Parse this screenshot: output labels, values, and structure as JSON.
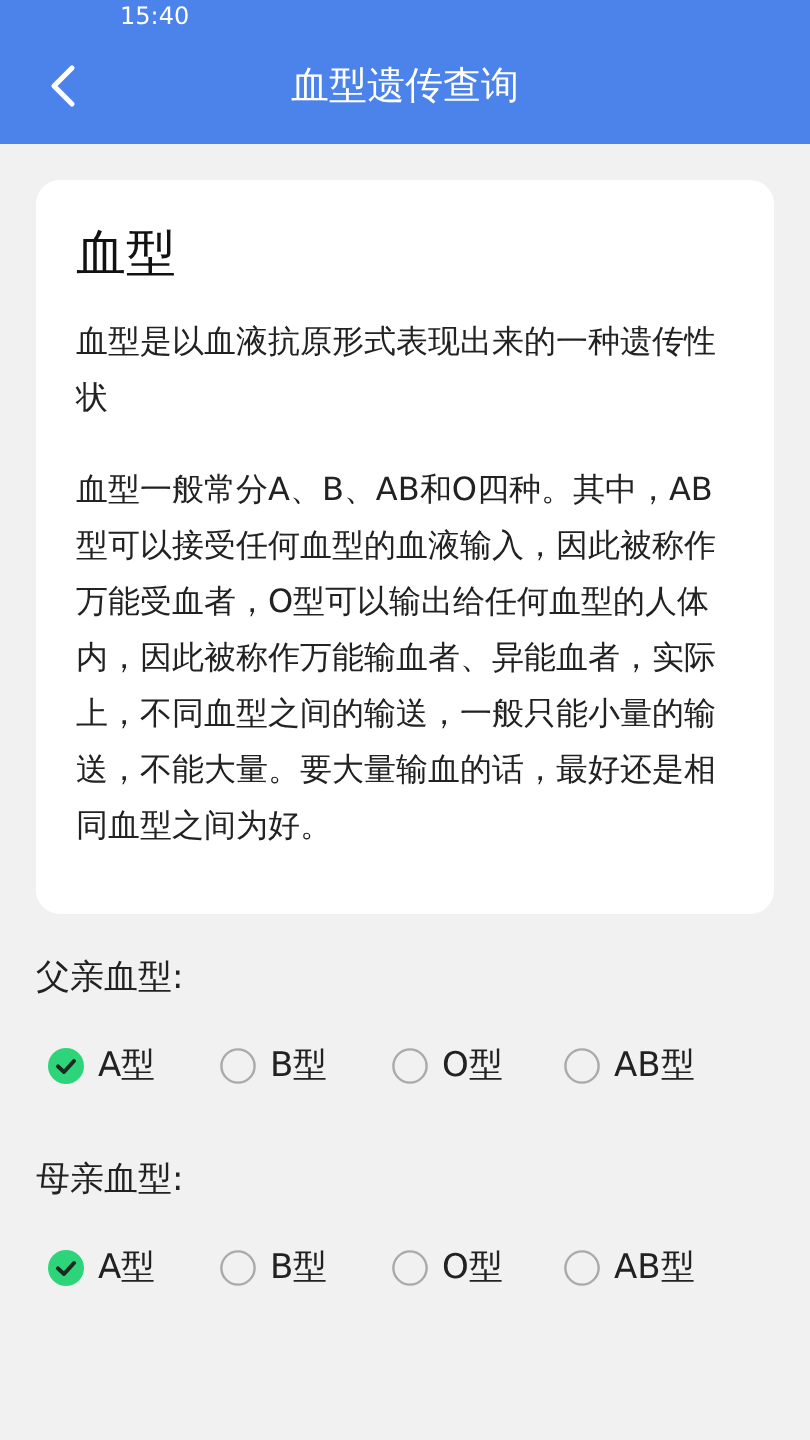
{
  "status_bar": {
    "time": "15:40"
  },
  "header": {
    "title": "血型遗传查询"
  },
  "card": {
    "title": "血型",
    "paragraphs": [
      "血型是以血液抗原形式表现出来的一种遗传性状",
      "血型一般常分A、B、AB和O四种。其中，AB型可以接受任何血型的血液输入，因此被称作万能受血者，O型可以输出给任何血型的人体内，因此被称作万能输血者、异能血者，实际上，不同血型之间的输送，一般只能小量的输送，不能大量。要大量输血的话，最好还是相同血型之间为好。"
    ]
  },
  "groups": [
    {
      "label": "父亲血型:",
      "options": [
        {
          "label": "A型",
          "selected": true
        },
        {
          "label": "B型",
          "selected": false
        },
        {
          "label": "O型",
          "selected": false
        },
        {
          "label": "AB型",
          "selected": false
        }
      ]
    },
    {
      "label": "母亲血型:",
      "options": [
        {
          "label": "A型",
          "selected": true
        },
        {
          "label": "B型",
          "selected": false
        },
        {
          "label": "O型",
          "selected": false
        },
        {
          "label": "AB型",
          "selected": false
        }
      ]
    }
  ]
}
